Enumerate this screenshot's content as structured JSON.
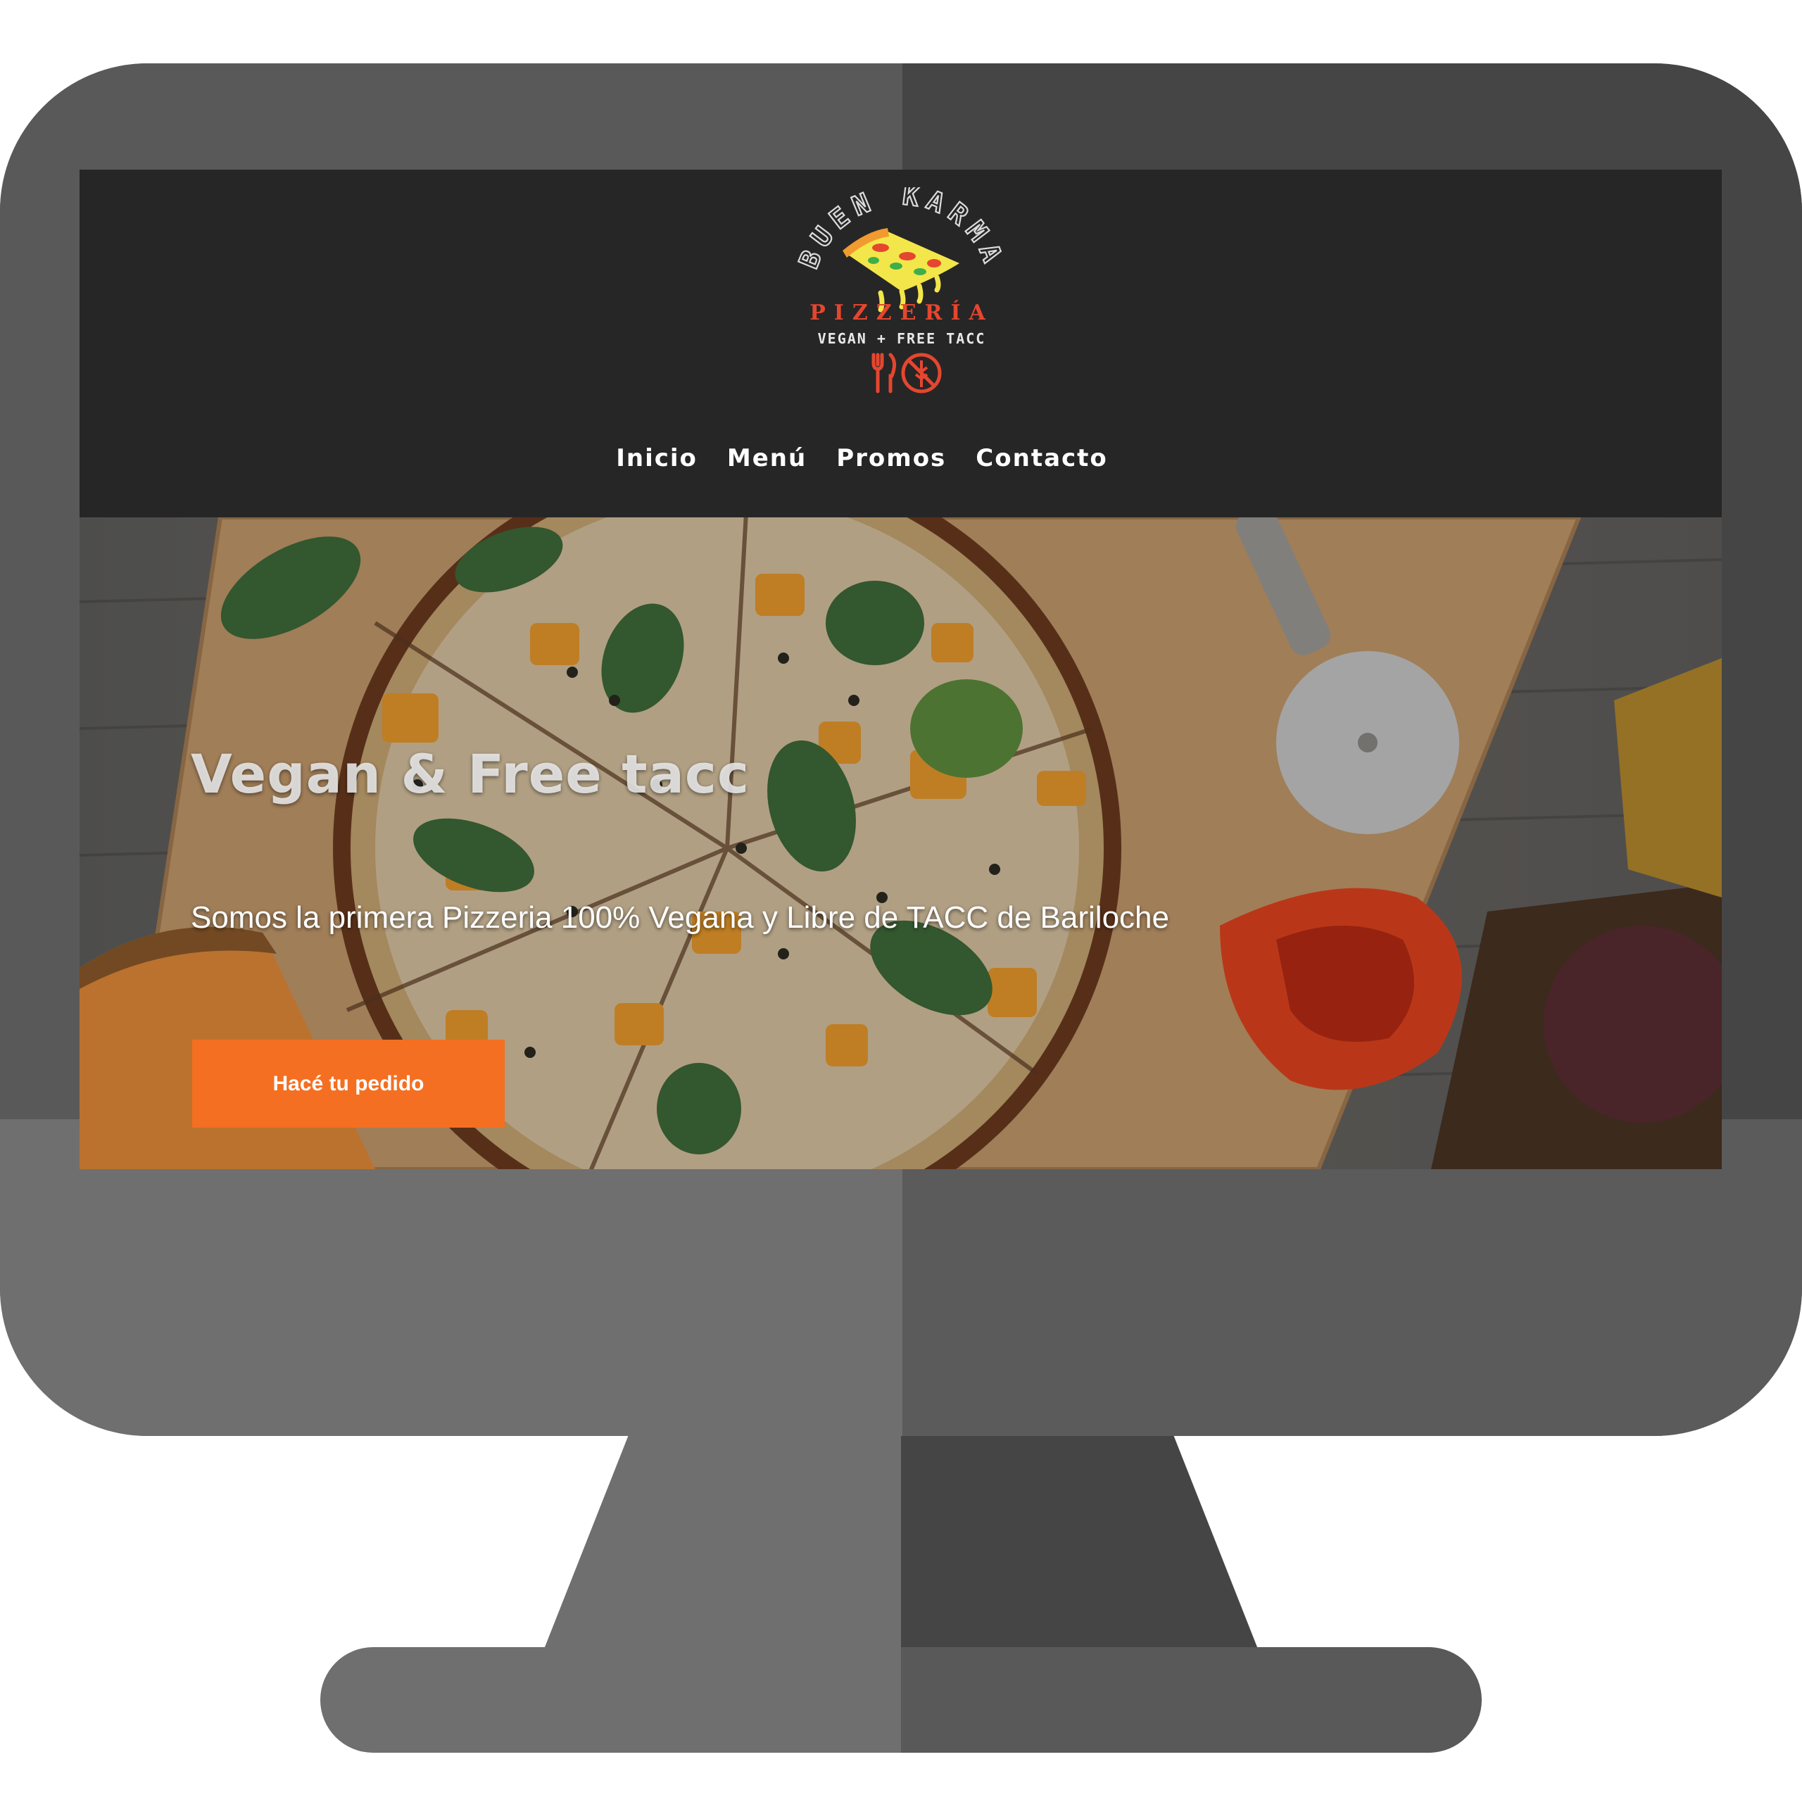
{
  "logo": {
    "arc_text": "BUEN KARMA",
    "name": "PIZZERÍA",
    "tagline": "VEGAN + FREE TACC",
    "icons": [
      "pizza-slice-icon",
      "fork-knife-icon",
      "no-gluten-icon"
    ]
  },
  "nav": {
    "items": [
      {
        "label": "Inicio"
      },
      {
        "label": "Menú"
      },
      {
        "label": "Promos"
      },
      {
        "label": "Contacto"
      }
    ]
  },
  "hero": {
    "title": "Vegan & Free tacc",
    "subtitle": "Somos la primera Pizzeria 100% Vegana y Libre de TACC de Bariloche",
    "cta_label": "Hacé tu pedido",
    "image": "pizza-photo"
  },
  "colors": {
    "header_bg": "#262626",
    "accent": "#f46f21",
    "logo_red": "#e5462f",
    "monitor": "#595959"
  }
}
